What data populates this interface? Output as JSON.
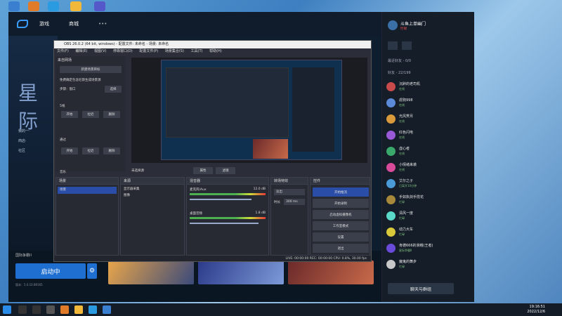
{
  "colors": {
    "accent": "#1e6fd0",
    "status_online": "#7fbf7f"
  },
  "bnet": {
    "nav": [
      "游戏",
      "商城",
      "•••"
    ],
    "hero_title": "星际",
    "side": [
      "我的一·",
      "商店·",
      "社区"
    ],
    "game_region": "国际争霸II",
    "launch_label": "启动中",
    "version": "版本：5.0.10.89165",
    "gear_icon": "gear-icon"
  },
  "friends": {
    "me_name": "斗鱼上单幽门",
    "me_status": "忙碌",
    "section_recent": "最近好友 - 0/0",
    "section_friends": "好友 - 22/199",
    "list": [
      {
        "name": "沉醉的老司机",
        "status": "在线"
      },
      {
        "name": "虐狗998",
        "status": "在线"
      },
      {
        "name": "光风霁月",
        "status": "在线"
      },
      {
        "name": "红色闪电",
        "status": "在线"
      },
      {
        "name": "虚心者",
        "status": "在线"
      },
      {
        "name": "小情绪来袭",
        "status": "在线"
      },
      {
        "name": "艾尔之子",
        "status": "已离开10分钟"
      },
      {
        "name": "手如执剑手揽花",
        "status": "忙碌"
      },
      {
        "name": "清风一度",
        "status": "忙碌"
      },
      {
        "name": "动力大车",
        "status": "忙碌"
      },
      {
        "name": "肯德666的滑稽(王者)",
        "status": "星际争霸II"
      },
      {
        "name": "魔鬼的舞步",
        "status": "忙碌"
      }
    ],
    "chat_button": "聊天与群组"
  },
  "obs": {
    "title": "OBS 26.0.2 (64 bit, windows) - 配置文件: 未命名 - 场景: 未命名",
    "menu": [
      "文件(F)",
      "编辑(E)",
      "视图(V)",
      "停靠窗口(D)",
      "配置文件(P)",
      "场景集合(S)",
      "工具(T)",
      "帮助(H)"
    ],
    "scene_panel_title": "来自网场",
    "scene_panel_btn": "新建场景目标",
    "scene_hint": "免费确定包含尼斯生成场景源",
    "scene_label": "步骤：窗口",
    "scene_label_btn": "选择",
    "section1": "5线",
    "section2": "通过",
    "section3": "音乐",
    "btn_open": "开始",
    "btn_middle": "拉近",
    "btn_delete": "删除",
    "source_label": "未选择源",
    "props_btn": "属性",
    "filters_btn": "滤镜",
    "scenes_header": "场景",
    "scene_item": "场景",
    "sources_header": "来源",
    "sources": [
      "显示器采集",
      "图像"
    ],
    "mixer_header": "混音器",
    "mixer_tracks": [
      {
        "name": "麦克风/Aux",
        "db": "12.0 dB"
      },
      {
        "name": "桌面音频",
        "db": "1.8 dB"
      }
    ],
    "transitions_header": "转场特效",
    "transition_value": "淡出",
    "duration_label": "时长",
    "duration_value": "300 ms",
    "controls_header": "控件",
    "controls": [
      "开始推流",
      "开始录制",
      "启动虚拟摄像机",
      "工作室模式",
      "设置",
      "退出"
    ],
    "status": "LIVE: 00:00:00    REC: 00:00:00    CPU: 0.8%, 30.00 fps"
  },
  "taskbar": {
    "time": "19:16:51",
    "date": "2022/12/6"
  }
}
